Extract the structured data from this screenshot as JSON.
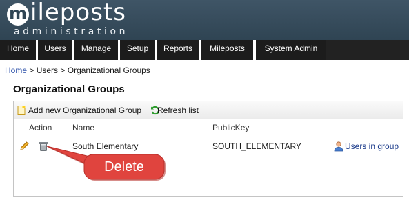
{
  "header": {
    "logo_letter": "m",
    "logo_word": "ileposts",
    "logo_subtitle": "administration"
  },
  "nav": {
    "items": [
      {
        "label": "Home"
      },
      {
        "label": "Users"
      },
      {
        "label": "Manage"
      },
      {
        "label": "Setup"
      },
      {
        "label": "Reports"
      },
      {
        "label": "Mileposts"
      },
      {
        "label": "System Admin"
      }
    ]
  },
  "breadcrumb": {
    "home": "Home",
    "sep1": " > ",
    "users": "Users",
    "sep2": " > ",
    "current": "Organizational Groups"
  },
  "page": {
    "title": "Organizational Groups"
  },
  "toolbar": {
    "add_label": "Add new Organizational Group",
    "refresh_label": "Refresh list"
  },
  "grid": {
    "columns": {
      "action": "Action",
      "name": "Name",
      "public_key": "PublicKey"
    },
    "rows": [
      {
        "name": "South Elementary",
        "public_key": "SOUTH_ELEMENTARY",
        "users_link": "Users in group"
      }
    ]
  },
  "annotation": {
    "label": "Delete",
    "color": "#e0443e"
  },
  "colors": {
    "header_bg": "#3f5566",
    "nav_bg": "#1c1c1c",
    "link": "#2a4fa8"
  },
  "icons": {
    "add": "new-document-icon",
    "refresh": "refresh-icon",
    "edit": "pencil-icon",
    "delete": "trash-icon",
    "users": "user-icon"
  }
}
